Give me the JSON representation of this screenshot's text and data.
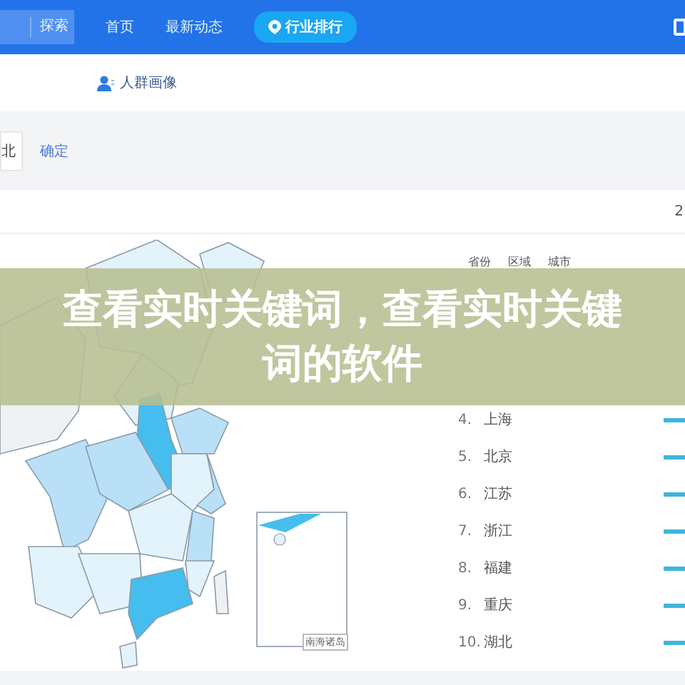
{
  "search": {
    "button": "探索"
  },
  "nav": [
    {
      "label": "首页",
      "selected": false
    },
    {
      "label": "最新动态",
      "selected": false
    },
    {
      "label": "行业排行",
      "selected": true
    }
  ],
  "subnav": {
    "label": "人群画像"
  },
  "filter": {
    "value": "北",
    "confirm": "确定"
  },
  "card": {
    "corner_text": "2"
  },
  "table": {
    "columns": [
      "省份",
      "区域",
      "城市"
    ],
    "rows": [
      {
        "rank": "4.",
        "name": "上海"
      },
      {
        "rank": "5.",
        "name": "北京"
      },
      {
        "rank": "6.",
        "name": "江苏"
      },
      {
        "rank": "7.",
        "name": "浙江"
      },
      {
        "rank": "8.",
        "name": "福建"
      },
      {
        "rank": "9.",
        "name": "重庆"
      },
      {
        "rank": "10.",
        "name": "湖北"
      }
    ]
  },
  "map": {
    "inset_label": "南海诸岛"
  },
  "banner": {
    "title": "查看实时关键词，查看实时关键词的软件"
  }
}
